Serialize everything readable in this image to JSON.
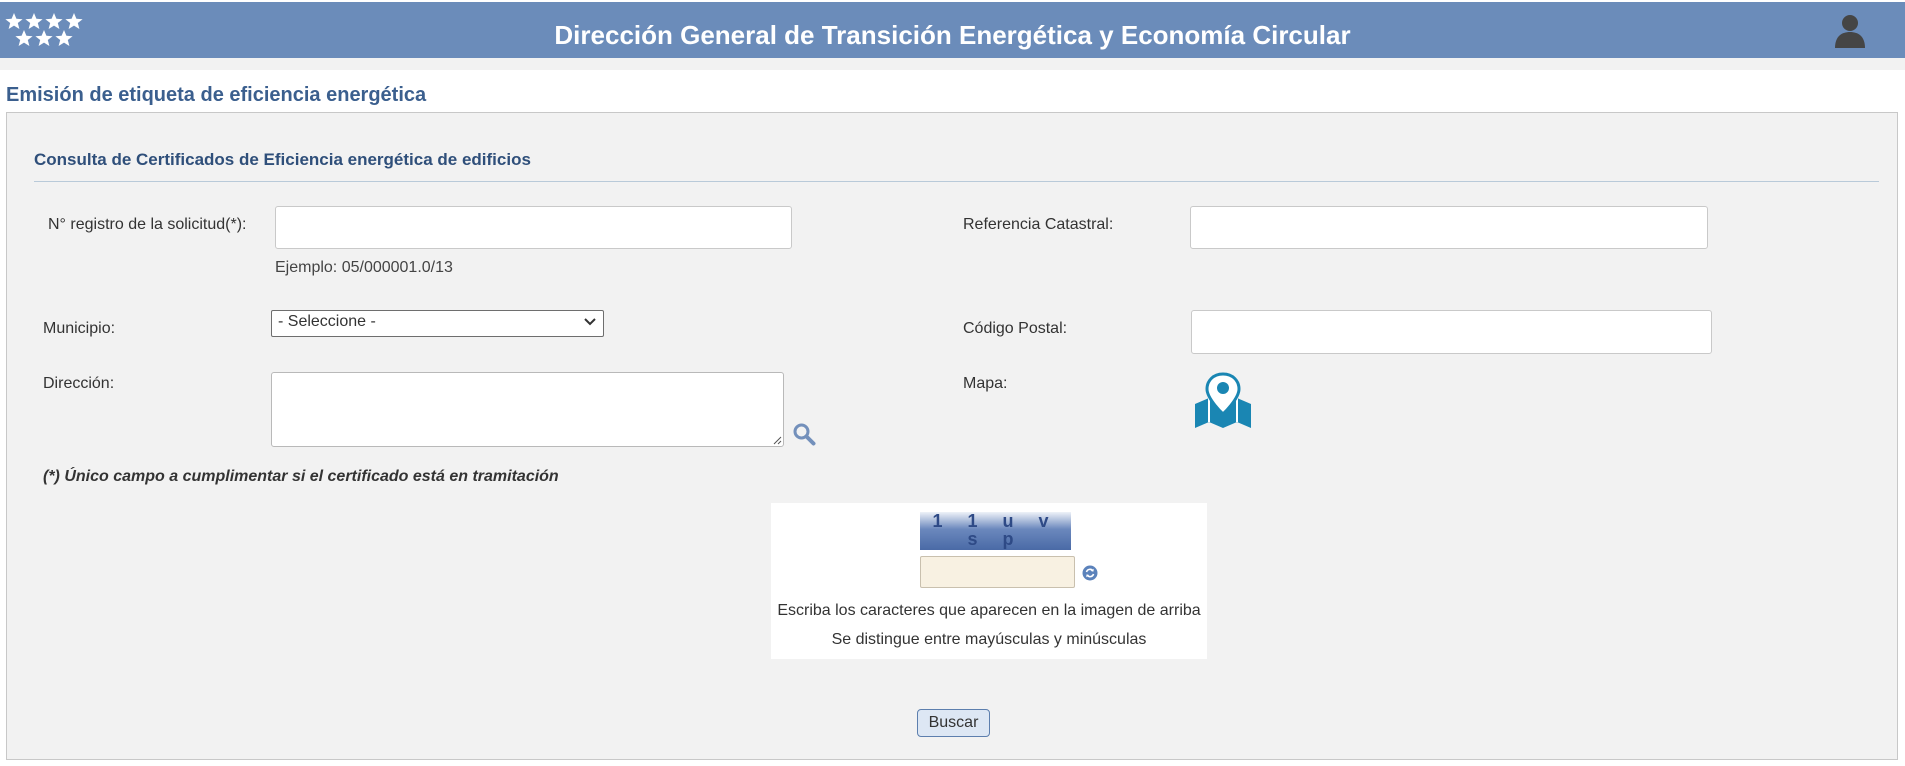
{
  "header": {
    "title": "Dirección General de Transición Energética y Economía Circular",
    "logo_icon": "stars-logo-icon",
    "user_icon": "user-icon",
    "color": "#6b8cba"
  },
  "page": {
    "title": "Emisión de etiqueta de eficiencia energética"
  },
  "section": {
    "title": "Consulta de Certificados de Eficiencia energética de edificios"
  },
  "form": {
    "registro_label": "N° registro de la solicitud(*):",
    "registro_value": "",
    "registro_hint": "Ejemplo: 05/000001.0/13",
    "catastral_label": "Referencia Catastral:",
    "catastral_value": "",
    "municipio_label": "Municipio:",
    "municipio_selected": "- Seleccione -",
    "postal_label": "Código Postal:",
    "postal_value": "",
    "direccion_label": "Dirección:",
    "direccion_value": "",
    "mapa_label": "Mapa:",
    "note": "(*) Único campo a cumplimentar si el certificado está en tramitación"
  },
  "captcha": {
    "text": "1 1 u v s p",
    "input_value": "",
    "line1": "Escriba los caracteres que aparecen en la imagen de arriba",
    "line2": "Se distingue entre mayúsculas y minúsculas"
  },
  "actions": {
    "search_label": "Buscar"
  },
  "icons": {
    "search": "magnifier-icon",
    "map": "map-pin-icon",
    "refresh": "refresh-icon",
    "dropdown": "chevron-down-icon"
  }
}
